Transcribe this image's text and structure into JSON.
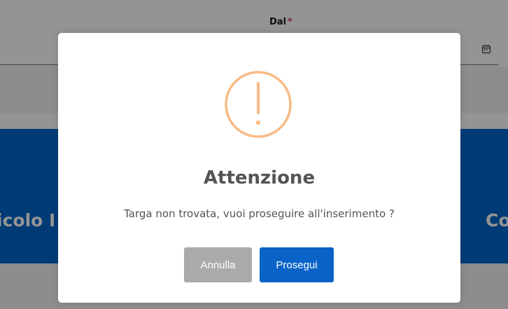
{
  "background": {
    "field_label": "Dal",
    "required_mark": "*",
    "calendar_icon": "calendar-icon",
    "column_left_partial": "icolo I",
    "column_right_partial": "Co",
    "colors": {
      "primary_blue": "#0066cc",
      "required_red": "#d9364f",
      "overlay": "rgba(0,0,0,0.42)"
    }
  },
  "dialog": {
    "icon": "warning-exclamation-icon",
    "icon_color": "#f8bb86",
    "title": "Attenzione",
    "message": "Targa non trovata, vuoi proseguire all'inserimento ?",
    "cancel_label": "Annulla",
    "confirm_label": "Prosegui",
    "colors": {
      "cancel_button": "#aaaaaa",
      "confirm_button": "#0a64c8"
    }
  }
}
